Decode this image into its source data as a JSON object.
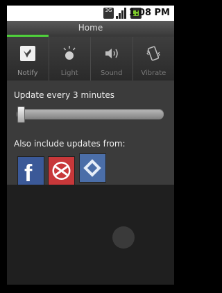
{
  "status_bar": {
    "network": "3G",
    "time": "1:08 PM",
    "signal_icon": "signal-icon",
    "battery_icon": "battery-icon"
  },
  "title_bar": {
    "title": "Home",
    "progress_fraction": 0.25,
    "progress_color": "#4fd13b"
  },
  "toolbar": {
    "items": [
      {
        "label": "Notify",
        "icon": "bird-icon",
        "active": true
      },
      {
        "label": "Light",
        "icon": "bulb-icon",
        "active": false
      },
      {
        "label": "Sound",
        "icon": "speaker-icon",
        "active": false
      },
      {
        "label": "Vibrate",
        "icon": "phone-vibrate-icon",
        "active": false
      }
    ]
  },
  "settings": {
    "update_label": "Update every 3 minutes",
    "slider_fraction": 0.0,
    "also_label": "Also include updates from:",
    "services": [
      {
        "name": "facebook-icon",
        "color": "#3b5998"
      },
      {
        "name": "mail-icon",
        "color": "#c8383a"
      },
      {
        "name": "foursquare-icon",
        "color": "#4b6ea8"
      }
    ]
  }
}
